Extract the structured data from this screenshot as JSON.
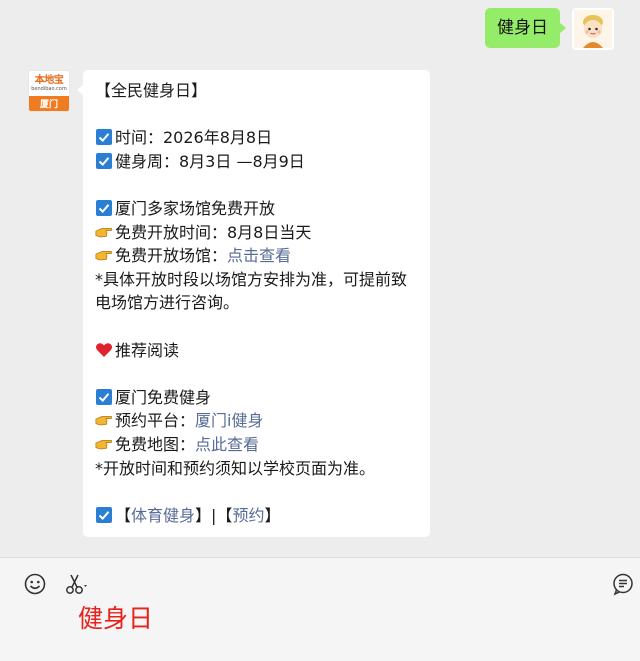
{
  "user_message": {
    "text": "健身日",
    "avatar_icon": "cartoon-child-avatar"
  },
  "bot": {
    "avatar": {
      "brand": "本地宝",
      "url_text": "bendibao.com",
      "city": "厦门",
      "brand_color": "#f07c22"
    },
    "message": {
      "title": "【全民健身日】",
      "time": "时间：2026年8月8日",
      "week": "健身周：8月3日 —8月9日",
      "venues_title": "厦门多家场馆免费开放",
      "open_time": "免费开放时间：8月8日当天",
      "open_venues_label": "免费开放场馆：",
      "open_venues_link": "点击查看",
      "note1": "*具体开放时段以场馆方安排为准，可提前致电场馆方进行咨询。",
      "recommend": "推荐阅读",
      "free_fitness": "厦门免费健身",
      "booking_label": "预约平台：",
      "booking_link": "厦门i健身",
      "map_label": "免费地图：",
      "map_link": "点此查看",
      "note2": "*开放时间和预约须知以学校页面为准。",
      "footer_open1": "【",
      "footer_link1": "体育健身",
      "footer_sep": "】|【",
      "footer_link2": "预约",
      "footer_close": "】"
    }
  },
  "input": {
    "draft_text": "健身日",
    "draft_color": "#e8211b",
    "icons": [
      "emoji-icon",
      "scissors-icon",
      "chat-history-icon"
    ]
  },
  "colors": {
    "user_bubble": "#95ec69",
    "link": "#576b95",
    "background": "#ededed"
  }
}
